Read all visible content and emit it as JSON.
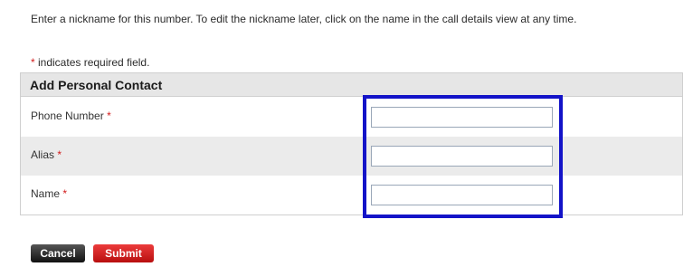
{
  "intro_text": "Enter a nickname for this number. To edit the nickname later, click on the name in the call details view at any time.",
  "required_note": {
    "star": "*",
    "text": " indicates required field."
  },
  "panel": {
    "title": "Add Personal Contact",
    "fields": [
      {
        "label": "Phone Number",
        "required_mark": "*",
        "value": ""
      },
      {
        "label": "Alias",
        "required_mark": "*",
        "value": ""
      },
      {
        "label": "Name",
        "required_mark": "*",
        "value": ""
      }
    ]
  },
  "buttons": {
    "cancel_label": "Cancel",
    "submit_label": "Submit"
  },
  "colors": {
    "required_star": "#d21b1b",
    "highlight_border": "#1313c8",
    "submit_bg": "#d32020",
    "cancel_bg": "#222222"
  }
}
